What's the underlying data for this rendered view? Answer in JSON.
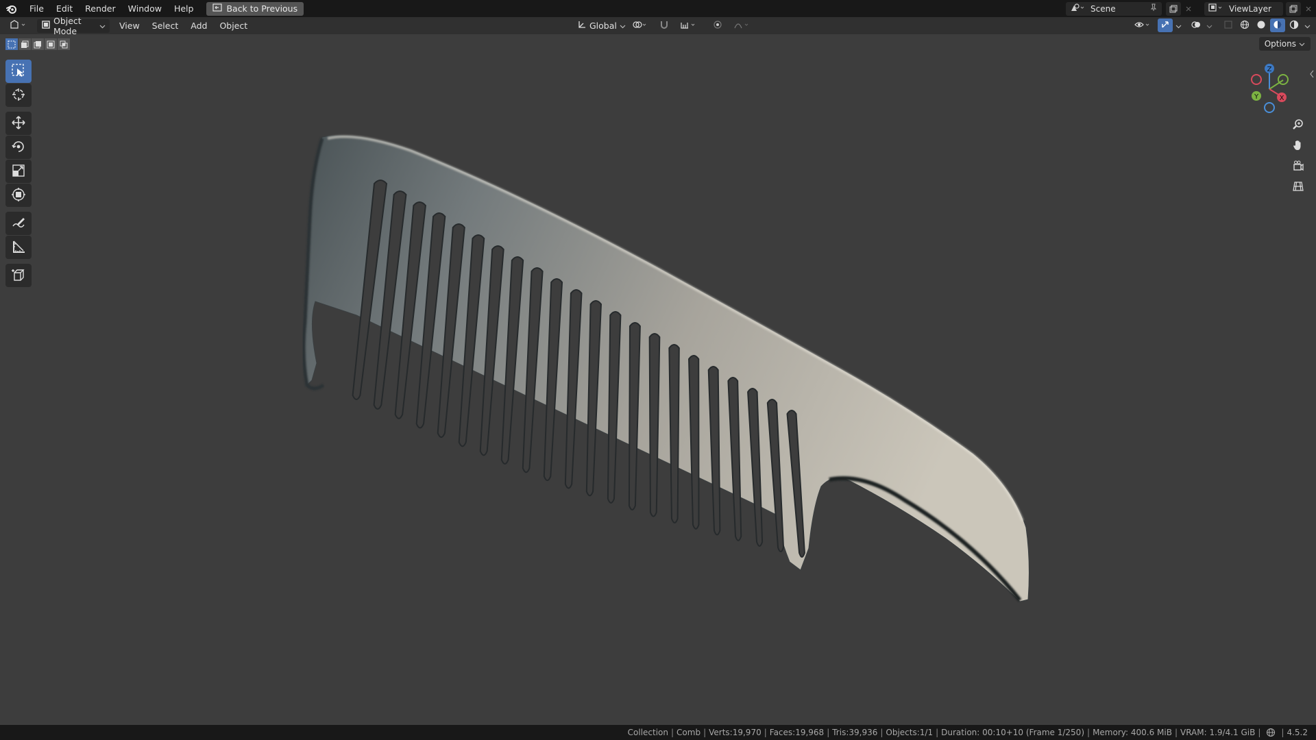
{
  "topbar": {
    "menu": [
      "File",
      "Edit",
      "Render",
      "Window",
      "Help"
    ],
    "back_label": "Back to Previous",
    "scene": "Scene",
    "view_layer": "ViewLayer"
  },
  "header": {
    "mode": "Object Mode",
    "menu": [
      "View",
      "Select",
      "Add",
      "Object"
    ],
    "orientation": "Global"
  },
  "viewport": {
    "options_label": "Options",
    "gizmo": {
      "z": "Z",
      "y": "Y",
      "x": "X"
    }
  },
  "statusbar": {
    "collection": "Collection",
    "object": "Comb",
    "verts": "Verts:19,970",
    "faces": "Faces:19,968",
    "tris": "Tris:39,936",
    "objects": "Objects:1/1",
    "duration": "Duration: 00:10+10 (Frame 1/250)",
    "memory": "Memory: 400.6 MiB",
    "vram": "VRAM: 1.9/4.1 GiB",
    "version": "4.5.2"
  },
  "colors": {
    "accent": "#4772b3",
    "axis_x": "#d94a5c",
    "axis_y": "#8bc34a",
    "axis_z": "#4a8fd9"
  }
}
